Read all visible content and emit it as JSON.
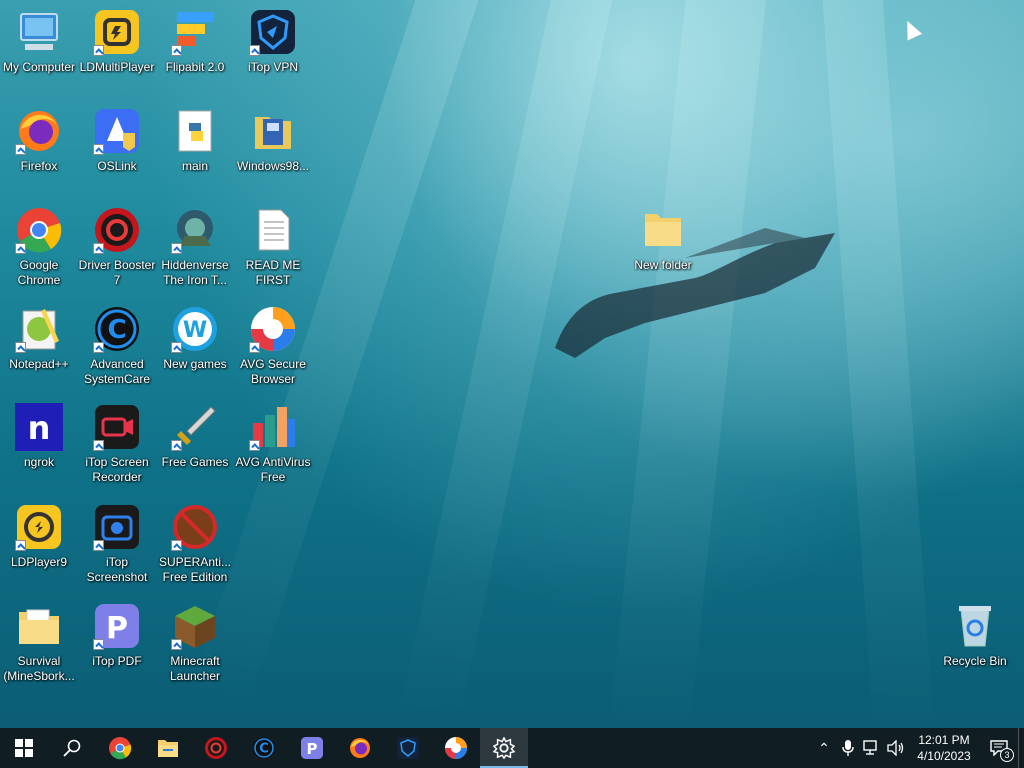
{
  "desktop": {
    "icons": [
      {
        "label": "My Computer",
        "icon": "computer-icon"
      },
      {
        "label": "LDMultiPlayer",
        "icon": "ldmultiplayer-icon"
      },
      {
        "label": "Flipabit 2.0",
        "icon": "flipabit-icon"
      },
      {
        "label": "iTop VPN",
        "icon": "itop-vpn-icon"
      },
      {
        "label": "Firefox",
        "icon": "firefox-icon"
      },
      {
        "label": "OSLink",
        "icon": "oslink-icon"
      },
      {
        "label": "main",
        "icon": "python-file-icon"
      },
      {
        "label": "Windows98...",
        "icon": "windows98-icon"
      },
      {
        "label": "Google Chrome",
        "icon": "chrome-icon"
      },
      {
        "label": "Driver Booster 7",
        "icon": "driver-booster-icon"
      },
      {
        "label": "Hiddenverse The Iron T...",
        "icon": "hiddenverse-icon"
      },
      {
        "label": "READ ME FIRST",
        "icon": "text-file-icon"
      },
      {
        "label": "Notepad++",
        "icon": "notepadpp-icon"
      },
      {
        "label": "Advanced SystemCare",
        "icon": "advanced-systemcare-icon"
      },
      {
        "label": "New games",
        "icon": "new-games-icon"
      },
      {
        "label": "AVG Secure Browser",
        "icon": "avg-browser-icon"
      },
      {
        "label": "ngrok",
        "icon": "ngrok-icon"
      },
      {
        "label": "iTop Screen Recorder",
        "icon": "itop-recorder-icon"
      },
      {
        "label": "Free Games",
        "icon": "sword-icon"
      },
      {
        "label": "AVG AntiVirus Free",
        "icon": "avg-antivirus-icon"
      },
      {
        "label": "LDPlayer9",
        "icon": "ldplayer-icon"
      },
      {
        "label": "iTop Screenshot",
        "icon": "itop-screenshot-icon"
      },
      {
        "label": "SUPERAnti... Free Edition",
        "icon": "superantispyware-icon"
      },
      {
        "label": "Survival (MineSbork...",
        "icon": "folder-icon"
      },
      {
        "label": "iTop PDF",
        "icon": "itop-pdf-icon"
      },
      {
        "label": "Minecraft Launcher",
        "icon": "minecraft-icon"
      }
    ],
    "new_folder": {
      "label": "New folder",
      "icon": "folder-icon"
    },
    "recycle_bin": {
      "label": "Recycle Bin",
      "icon": "recycle-bin-icon"
    }
  },
  "taskbar": {
    "pinned": [
      "start-icon",
      "search-icon",
      "chrome-icon",
      "file-explorer-icon",
      "driver-booster-icon",
      "advanced-systemcare-icon",
      "itop-pdf-icon",
      "firefox-icon",
      "itop-vpn-icon",
      "avg-browser-icon",
      "settings-icon"
    ],
    "time": "12:01 PM",
    "date": "4/10/2023",
    "notification_count": "3"
  }
}
